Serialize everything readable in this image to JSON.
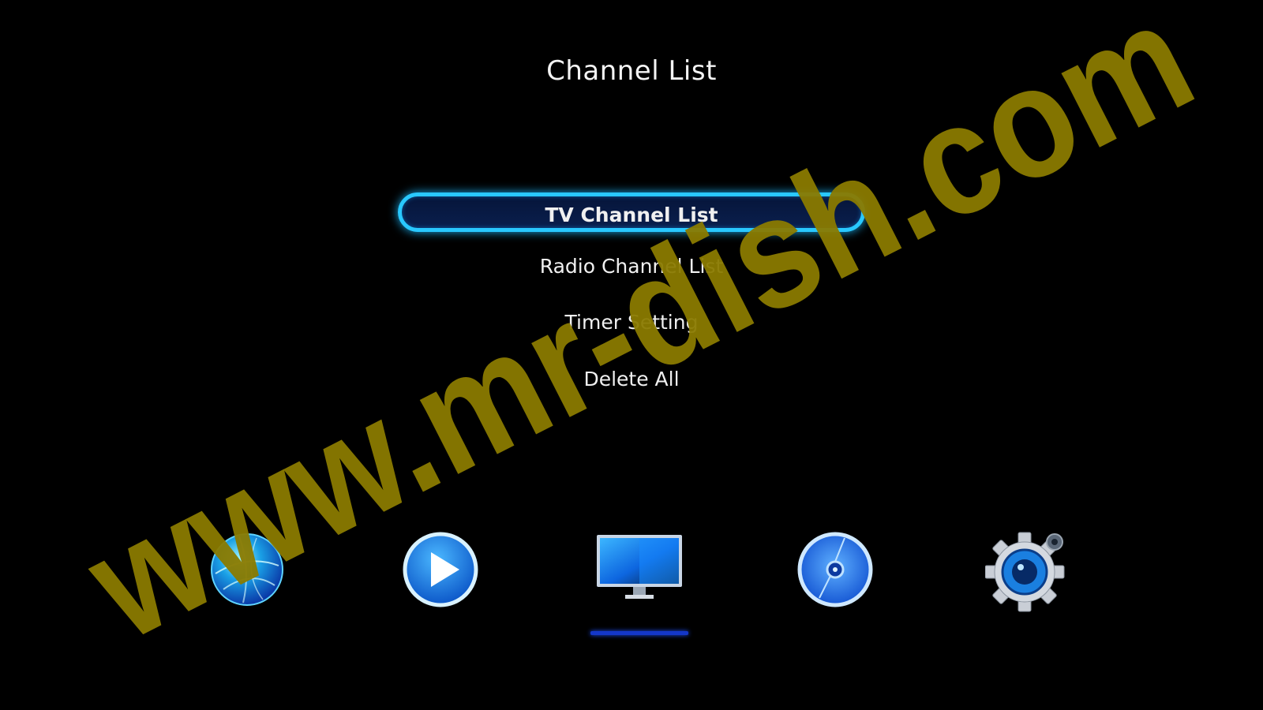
{
  "header": {
    "title": "Channel List"
  },
  "menu": {
    "items": [
      {
        "label": "TV Channel List",
        "selected": true
      },
      {
        "label": "Radio Channel List",
        "selected": false
      },
      {
        "label": "Timer Setting",
        "selected": false
      },
      {
        "label": "Delete All",
        "selected": false
      }
    ]
  },
  "dock": {
    "items": [
      {
        "icon": "globe-icon"
      },
      {
        "icon": "play-icon"
      },
      {
        "icon": "tv-monitor-icon",
        "active": true
      },
      {
        "icon": "disc-icon"
      },
      {
        "icon": "settings-gear-icon"
      }
    ]
  },
  "watermark": {
    "text": "www.mr-dish.com",
    "color": "#8a7a00"
  },
  "colors": {
    "accent": "#29c8ff",
    "selected_bg": "#0a1f4d",
    "underline": "#1437c9"
  }
}
